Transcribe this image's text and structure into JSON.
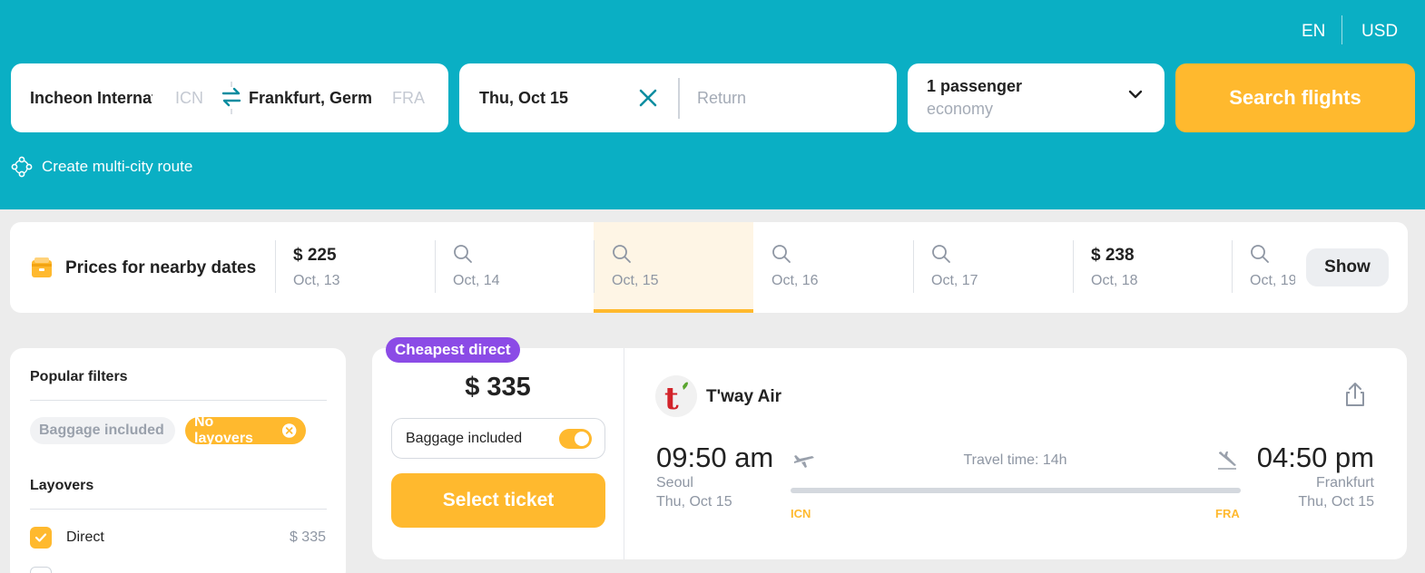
{
  "header": {
    "language": "EN",
    "currency": "USD",
    "accent_color": "#0aafc4"
  },
  "search": {
    "origin": "Incheon International Airport",
    "origin_code": "ICN",
    "destination": "Frankfurt, Germany",
    "destination_code": "FRA",
    "depart_date": "Thu, Oct 15",
    "return_placeholder": "Return",
    "passengers": "1 passenger",
    "cabin_class": "economy",
    "search_button": "Search flights",
    "multi_city": "Create multi-city route"
  },
  "nearby_dates": {
    "title": "Prices for nearby dates",
    "show_button": "Show",
    "dates": [
      {
        "price": "$ 225",
        "date": "Oct, 13",
        "selected": false
      },
      {
        "price": "",
        "date": "Oct, 14",
        "selected": false
      },
      {
        "price": "",
        "date": "Oct, 15",
        "selected": true
      },
      {
        "price": "",
        "date": "Oct, 16",
        "selected": false
      },
      {
        "price": "",
        "date": "Oct, 17",
        "selected": false
      },
      {
        "price": "$ 238",
        "date": "Oct, 18",
        "selected": false
      },
      {
        "price": "",
        "date": "Oct, 19",
        "selected": false
      }
    ]
  },
  "filters": {
    "popular_title": "Popular filters",
    "chips": [
      {
        "label": "Baggage included",
        "active": false
      },
      {
        "label": "No layovers",
        "active": true
      }
    ],
    "layovers_title": "Layovers",
    "layovers": [
      {
        "label": "Direct",
        "price": "$ 335",
        "checked": true
      }
    ]
  },
  "ticket": {
    "badge": "Cheapest direct",
    "badge_color": "#8b4be6",
    "price": "$ 335",
    "baggage_label": "Baggage included",
    "baggage_on": true,
    "select_button": "Select ticket",
    "airline": "T'way Air",
    "logo_text": "t",
    "departure": {
      "time": "09:50 am",
      "city": "Seoul",
      "date": "Thu, Oct 15",
      "code": "ICN"
    },
    "arrival": {
      "time": "04:50 pm",
      "city": "Frankfurt",
      "date": "Thu, Oct 15",
      "code": "FRA"
    },
    "travel_time": "Travel time: 14h"
  }
}
